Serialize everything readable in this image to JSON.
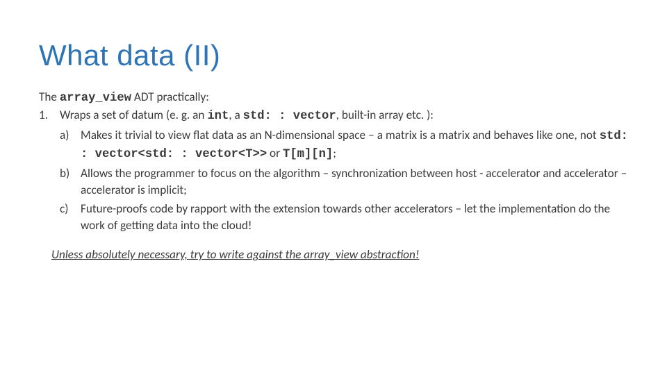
{
  "title": "What data (II)",
  "intro_pre": "The ",
  "intro_code": "array_view",
  "intro_post": " ADT practically:",
  "item1": {
    "marker": "1.",
    "text_pre": "Wraps a set of datum (e. g. an ",
    "code1": "int",
    "text_mid1": ", a ",
    "code2": "std: : vector",
    "text_post": ", built-in array etc. ):"
  },
  "sub": {
    "a": {
      "marker": "a)",
      "pre": "Makes it trivial to view flat data as an N-dimensional space – a matrix is a matrix and behaves like one, not ",
      "code1": "std: : vector<std: : vector<T>>",
      "mid": " or ",
      "code2": "T[m][n]",
      "post": ";"
    },
    "b": {
      "marker": "b)",
      "text": "Allows the programmer to focus on the algorithm – synchronization between host - accelerator and accelerator – accelerator is implicit;"
    },
    "c": {
      "marker": "c)",
      "text": "Future-proofs code by rapport with the extension towards other accelerators – let the implementation do the work of getting data into the cloud!"
    }
  },
  "callout": "Unless absolutely necessary, try to write against the array_view abstraction!"
}
